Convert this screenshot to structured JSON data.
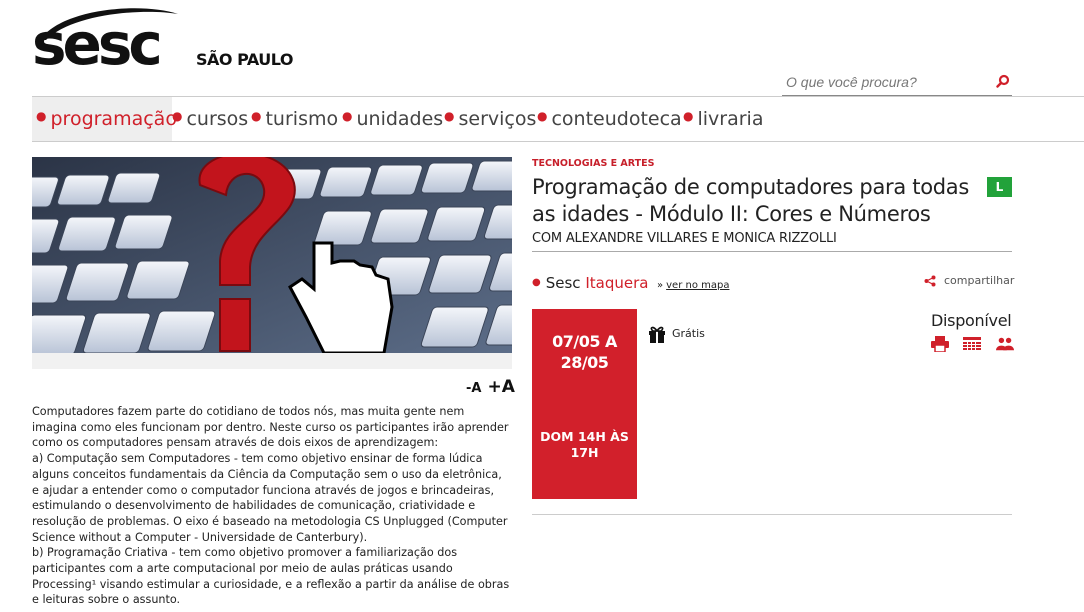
{
  "brand": {
    "logo": "sesc",
    "city": "SÃO PAULO",
    "accent": "#d0202a"
  },
  "search": {
    "placeholder": "O que você procura?"
  },
  "nav": {
    "items": [
      {
        "label": "programação",
        "active": true
      },
      {
        "label": "cursos"
      },
      {
        "label": "turismo"
      },
      {
        "label": "unidades"
      },
      {
        "label": "serviços"
      },
      {
        "label": "conteudoteca"
      },
      {
        "label": "livraria"
      }
    ]
  },
  "fontsize": {
    "decrease": "-A",
    "increase": "+A"
  },
  "description": [
    "Computadores fazem parte do cotidiano de todos nós, mas muita gente nem imagina como eles funcionam por dentro. Neste curso os participantes irão aprender como os computadores pensam através de dois eixos de aprendizagem:",
    "a) Computação sem Computadores - tem como objetivo ensinar de forma lúdica alguns conceitos fundamentais da Ciência da Computação sem o uso da eletrônica, e ajudar a entender como o computador funciona através de jogos e brincadeiras, estimulando o desenvolvimento de habilidades de comunicação, criatividade e resolução de problemas. O eixo é baseado na metodologia CS Unplugged (Computer Science without a Computer - Universidade de Canterbury).",
    "b) Programação Criativa - tem como objetivo promover a familiarização dos participantes com a arte computacional por meio de aulas práticas usando Processing¹ visando estimular a curiosidade, e a reflexão a partir da análise de obras e leituras sobre o assunto."
  ],
  "event": {
    "category": "TECNOLOGIAS E ARTES",
    "title": "Programação de computadores para todas as idades - Módulo II: Cores e Números",
    "rating": "L",
    "subtitle": "COM ALEXANDRE VILLARES E MONICA RIZZOLLI",
    "unit_prefix": "Sesc",
    "unit_name": "Itaquera",
    "map_link": "ver no mapa",
    "share": "compartilhar",
    "date_range": "07/05 A 28/05",
    "schedule": "DOM 14H ÀS 17H",
    "price": "Grátis",
    "status": "Disponível",
    "icons": [
      "print-icon",
      "calendar-icon",
      "people-icon"
    ]
  }
}
